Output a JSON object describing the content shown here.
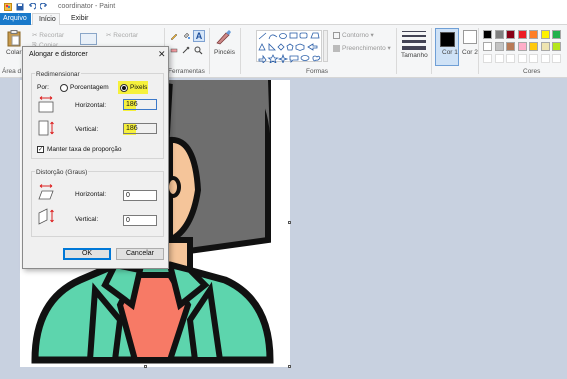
{
  "window": {
    "title": "coordinator - Paint"
  },
  "tabs": [
    {
      "label": "Arquivo"
    },
    {
      "label": "Início"
    },
    {
      "label": "Exibir"
    }
  ],
  "ribbon": {
    "clipboard": {
      "paste": "Colar",
      "cut": "Recortar",
      "copy": "Copiar"
    },
    "image_group": "Área d",
    "tools_group": "Ferramentas",
    "brushes": "Pincéis",
    "shapes_group": "Formas",
    "outline": "Contorno",
    "fill": "Preenchimento",
    "size": "Tamanho",
    "color1": "Cor 1",
    "color2": "Cor 2",
    "colors_group": "Cores"
  },
  "palette": [
    "#000000",
    "#7f7f7f",
    "#880015",
    "#ed1c24",
    "#ff7f27",
    "#fff200",
    "#22b14c",
    "#ffffff",
    "#c3c3c3",
    "#b97a57",
    "#ffaec9",
    "#ffc90e",
    "#efe4b0",
    "#b5e61d"
  ],
  "colors_state": {
    "color1": "#000000",
    "color2": "#ffffff"
  },
  "dialog": {
    "title": "Alongar e distorcer",
    "close": "✕",
    "resize_section": "Redimensionar",
    "by_label": "Por:",
    "percentage_label": "Porcentagem",
    "pixels_label": "Pixels",
    "selected_unit": "Pixels",
    "horizontal_label": "Horizontal:",
    "vertical_label": "Vertical:",
    "horizontal_value": "186",
    "vertical_value": "186",
    "keep_ratio_label": "Manter taxa de proporção",
    "keep_ratio_checked": true,
    "skew_section": "Distorção (Graus)",
    "skew_horizontal_label": "Horizontal:",
    "skew_vertical_label": "Vertical:",
    "skew_horizontal_value": "0",
    "skew_vertical_value": "0",
    "ok_label": "OK",
    "cancel_label": "Cancelar",
    "highlight_color": "#f6f13c"
  }
}
